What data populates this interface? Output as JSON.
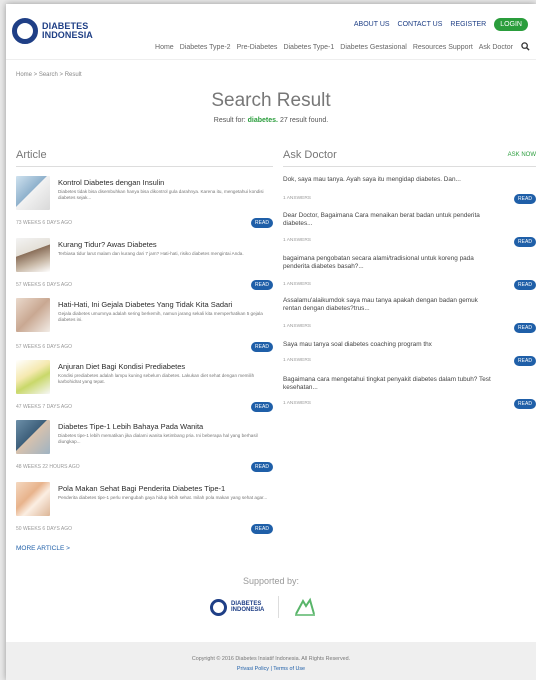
{
  "header": {
    "brand_line1": "DIABETES",
    "brand_line2": "INDONESIA",
    "top_links": [
      "ABOUT US",
      "CONTACT US",
      "REGISTER"
    ],
    "login": "LOGIN",
    "nav": [
      "Home",
      "Diabetes Type-2",
      "Pre-Diabetes",
      "Diabetes Type-1",
      "Diabetes Gestasional",
      "Resources Support",
      "Ask Doctor"
    ]
  },
  "breadcrumb": "Home > Search > Result",
  "search": {
    "title": "Search Result",
    "result_prefix": "Result for:",
    "keyword": "diabetes.",
    "result_suffix": "27 result found."
  },
  "article": {
    "heading": "Article",
    "items": [
      {
        "title": "Kontrol Diabetes dengan Insulin",
        "desc": "Diabetes tidak bisa disembuhkan hanya bisa dikontrol gula darahnya. Karena itu, mengetahui kondisi diabetes sejak...",
        "ago": "73 WEEKS 6 DAYS AGO",
        "read": "READ"
      },
      {
        "title": "Kurang Tidur? Awas Diabetes",
        "desc": "Terbiasa tidur larut malam dan kurang dari 7 jam? Hati-hati, risiko diabetes mengintai Anda.",
        "ago": "57 WEEKS 6 DAYS AGO",
        "read": "READ"
      },
      {
        "title": "Hati-Hati, Ini Gejala Diabetes Yang Tidak Kita Sadari",
        "desc": "Gejala diabetes umumnya adalah sering berkemih, namun jarang sekali kita memperhatikan 5 gejala diabetes ini.",
        "ago": "57 WEEKS 6 DAYS AGO",
        "read": "READ"
      },
      {
        "title": "Anjuran Diet Bagi Kondisi Prediabetes",
        "desc": "Kondisi prediabetes adalah lampu kuning sebelum diabetes. Lakukan diet sehat dengan memilih karbohidrat yang tepat.",
        "ago": "47 WEEKS 7 DAYS AGO",
        "read": "READ"
      },
      {
        "title": "Diabetes Tipe-1 Lebih Bahaya Pada Wanita",
        "desc": "Diabetes tipe-1 lebih mematikan jika dialami wanita ketimbang pria. Ini beberapa hal yang berhasil diungkap...",
        "ago": "48 WEEKS 22 HOURS AGO",
        "read": "READ"
      },
      {
        "title": "Pola Makan Sehat Bagi Penderita Diabetes Tipe-1",
        "desc": "Penderita diabetes tipe-1 perlu mengubah gaya hidup lebih sehat. Inilah pola makan yang sehat agar...",
        "ago": "50 WEEKS 6 DAYS AGO",
        "read": "READ"
      }
    ],
    "more": "MORE ARTICLE >"
  },
  "ask": {
    "heading": "Ask Doctor",
    "ask_now": "ASK NOW",
    "items": [
      {
        "q": "Dok, saya mau tanya. Ayah saya itu mengidap diabetes. Dan...",
        "answers": "1 ANSWERS",
        "read": "READ"
      },
      {
        "q": "Dear Doctor, Bagaimana Cara menaikan berat badan untuk penderita diabetes...",
        "answers": "1 ANSWERS",
        "read": "READ"
      },
      {
        "q": "bagaimana pengobatan secara alami/tradisional untuk koreng pada penderita diabetes basah?...",
        "answers": "1 ANSWERS",
        "read": "READ"
      },
      {
        "q": "Assalamu'alaikumdok saya mau tanya apakah dengan badan gemuk rentan dengan diabetes?trus...",
        "answers": "1 ANSWERS",
        "read": "READ"
      },
      {
        "q": "Saya mau tanya soal diabetes coaching program thx",
        "answers": "1 ANSWERS",
        "read": "READ"
      },
      {
        "q": "Bagaimana cara mengetahui tingkat penyakit diabetes dalam tubuh? Test kesehatan...",
        "answers": "1 ANSWERS",
        "read": "READ"
      }
    ]
  },
  "supported_by": "Supported by:",
  "footer": {
    "copyright": "Copyright © 2016 Diabetes Insiatif Indonesia. All Rights Reserved.",
    "privacy": "Privasi Policy",
    "sep": "|",
    "terms": "Terms of Use"
  },
  "colors": {
    "brand_blue": "#1f3f86",
    "accent_green": "#2a9d3c",
    "read_blue": "#1f5fa8"
  },
  "icons": {
    "search": "search-icon",
    "logo": "diabetes-indonesia-logo",
    "partner": "partner-logo"
  }
}
